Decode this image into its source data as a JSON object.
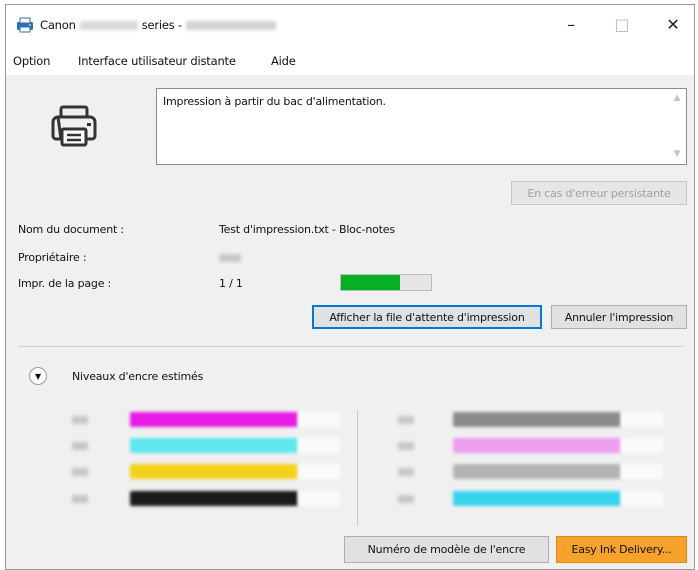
{
  "window": {
    "title_prefix": "Canon",
    "title_mid": "series -",
    "controls": {
      "minimize": "–",
      "maximize": "□",
      "close": "✕"
    }
  },
  "menu": [
    "Option",
    "Interface utilisateur distante",
    "Aide"
  ],
  "status": {
    "message": "Impression à partir du bac d'alimentation.",
    "error_button": "En cas d'erreur persistante"
  },
  "job": {
    "document_label": "Nom du document :",
    "document_value": "Test d'impression.txt - Bloc-notes",
    "owner_label": "Propriétaire :",
    "page_label": "Impr. de la page :",
    "page_value": "1 / 1",
    "progress_fraction": 0.66
  },
  "buttons": {
    "queue": "Afficher la file d'attente d'impression",
    "cancel": "Annuler l'impression",
    "ink_model": "Numéro de modèle de l'encre",
    "easy_ink": "Easy Ink Delivery..."
  },
  "ink": {
    "title": "Niveaux d'encre estimés",
    "left": [
      {
        "color": "#e61ce6",
        "level": 0.8
      },
      {
        "color": "#5ee8ee",
        "level": 0.8
      },
      {
        "color": "#f4d21a",
        "level": 0.8
      },
      {
        "color": "#1a1a1a",
        "level": 0.8
      }
    ],
    "right": [
      {
        "color": "#8c8c8c",
        "level": 0.8
      },
      {
        "color": "#ec9ef0",
        "level": 0.8
      },
      {
        "color": "#b4b4b4",
        "level": 0.8
      },
      {
        "color": "#38d4ee",
        "level": 0.8
      }
    ]
  }
}
